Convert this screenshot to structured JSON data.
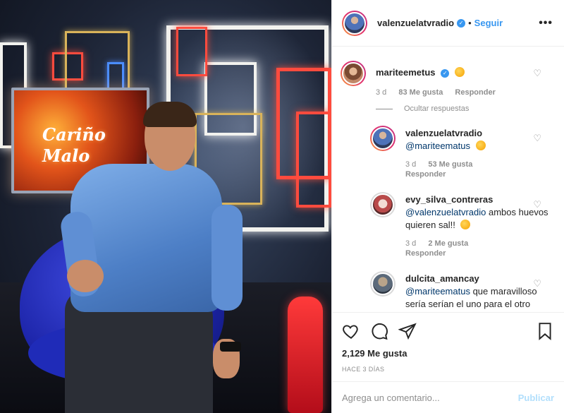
{
  "post": {
    "author": "valenzuelatvradio",
    "follow_label": "Seguir",
    "more_label": "•••",
    "photo_text": "Cariño Malo",
    "likes": "2,129 Me gusta",
    "time": "HACE 3 DÍAS"
  },
  "comments": [
    {
      "user": "mariteemetus",
      "verified": true,
      "time": "3 d",
      "likes": "83 Me gusta",
      "reply_label": "Responder",
      "toggle_label": "Ocultar respuestas",
      "replies": [
        {
          "user": "valenzuelatvradio",
          "verified": true,
          "mention": "@mariteematus",
          "text": "",
          "time": "3 d",
          "likes": "53 Me gusta",
          "reply_label": "Responder"
        },
        {
          "user": "evy_silva_contreras",
          "verified": false,
          "mention": "@valenzuelatvradio",
          "text": "ambos huevos quieren sal!!",
          "time": "3 d",
          "likes": "2 Me gusta",
          "reply_label": "Responder"
        },
        {
          "user": "dulcita_amancay",
          "verified": false,
          "mention": "@mariteematus",
          "text": "que maravilloso sería serían el uno para el otro"
        }
      ]
    }
  ],
  "composer": {
    "placeholder": "Agrega un comentario...",
    "publish_label": "Publicar"
  },
  "colors": {
    "accent": "#3897f0",
    "publish_disabled": "#b2dffc",
    "muted": "#8e8e8e"
  },
  "icons": [
    "heart-icon",
    "comment-icon",
    "share-icon",
    "bookmark-icon",
    "verified-badge-icon",
    "more-options-icon"
  ]
}
